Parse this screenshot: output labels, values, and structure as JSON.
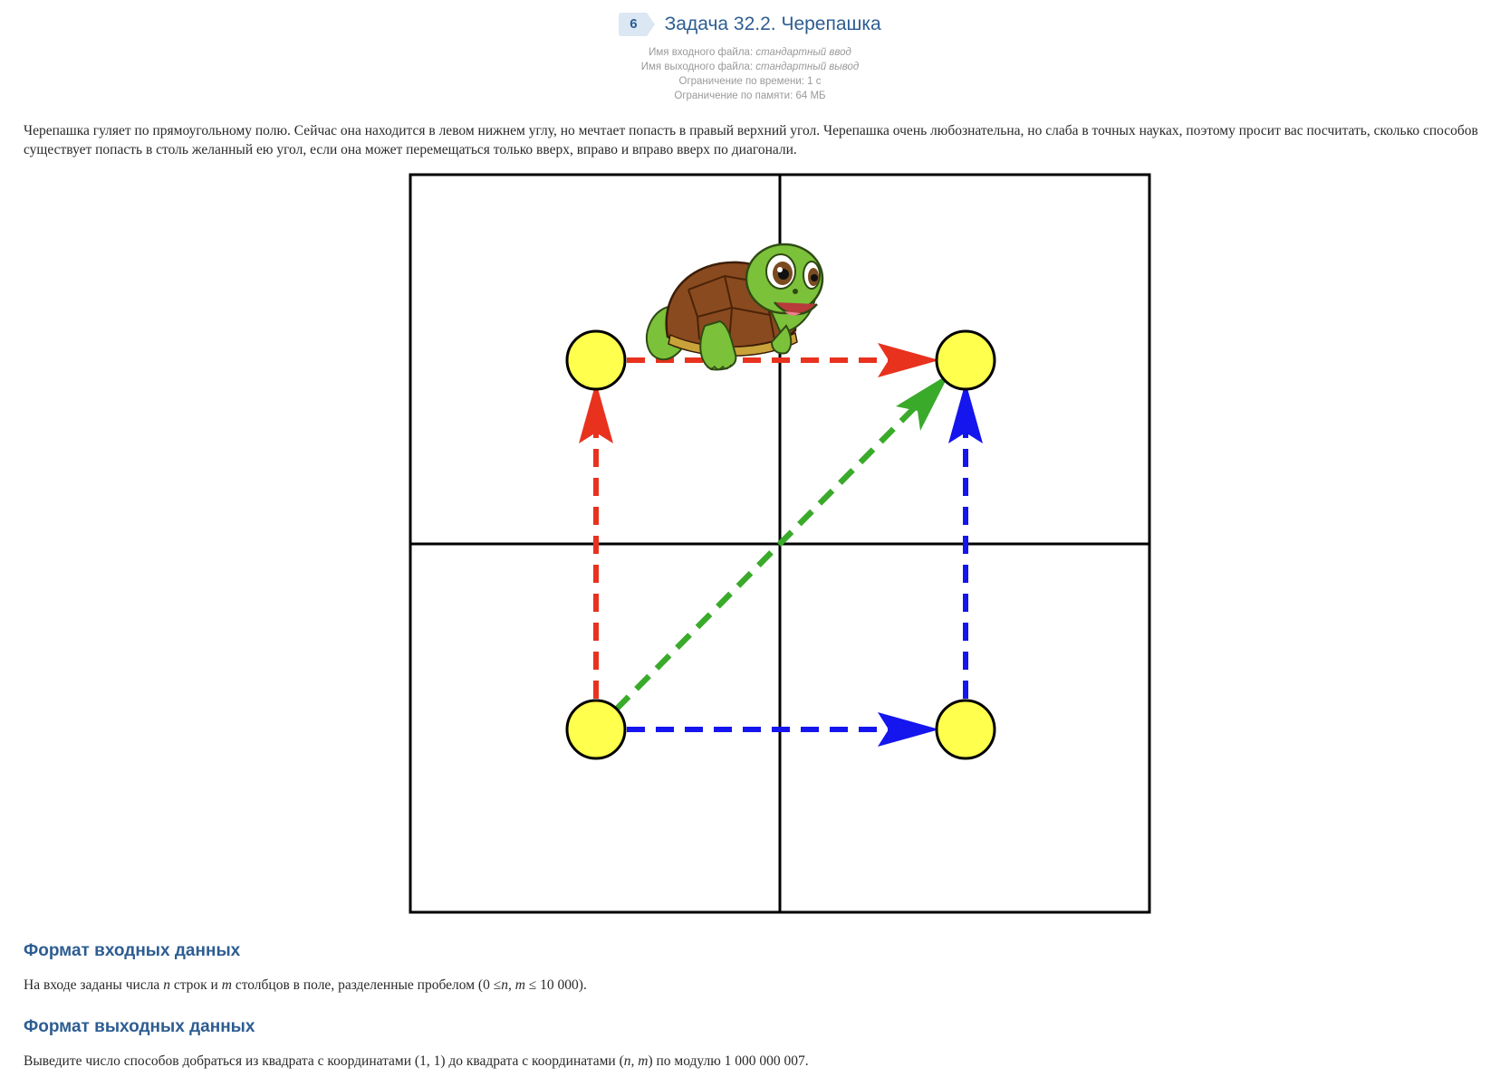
{
  "problem": {
    "number": "6",
    "title": "Задача 32.2. Черепашка",
    "input_file_label": "Имя входного файла:",
    "input_file_value": "стандартный ввод",
    "output_file_label": "Имя выходного файла:",
    "output_file_value": "стандартный вывод",
    "time_limit": "Ограничение по времени: 1 с",
    "memory_limit": "Ограничение по памяти: 64 МБ"
  },
  "statement": "Черепашка гуляет по прямоугольному полю. Сейчас она находится в левом нижнем углу, но мечтает попасть в правый верхний угол. Черепашка очень любознательна, но слаба в точных науках, поэтому просит вас посчитать, сколько способов существует попасть в столь желанный ею угол, если она может перемещаться только вверх, вправо и вправо вверх по диагонали.",
  "figure": {
    "colors": {
      "grid": "#000000",
      "node": "#ffff4d",
      "path_up_right": "#e8321e",
      "path_diagonal": "#3aaa2a",
      "path_right_up": "#1515ee",
      "turtle_shell": "#8a4a1f",
      "turtle_skin": "#7cc13a"
    },
    "grid_cells": [
      2,
      2
    ]
  },
  "input_format": {
    "heading": "Формат входных данных",
    "text_1": "На входе заданы числа",
    "n": "n",
    "text_2": "строк и",
    "m": "m",
    "text_3": "столбцов в поле, разделенные пробелом",
    "constraint_open": "(0 ≤",
    "constraint_vars": "n, m",
    "constraint_close": "≤ 10 000)."
  },
  "output_format": {
    "heading": "Формат выходных данных",
    "text_1": "Выведите число способов добраться из квадрата с координатами",
    "start": "(1, 1)",
    "text_2": "до квадрата с координатами",
    "end_open": "(",
    "end_vars": "n, m",
    "end_close": ")",
    "text_3": "по модулю",
    "modulus": "1 000 000 007",
    "dot": "."
  }
}
